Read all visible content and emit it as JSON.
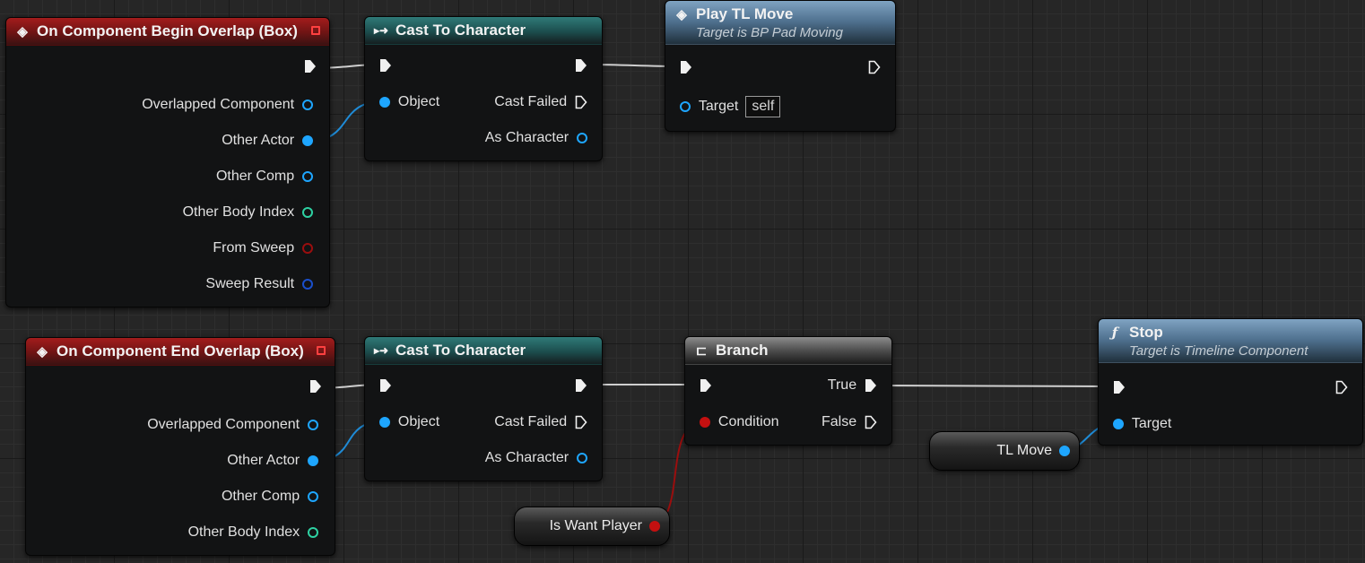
{
  "nodes": {
    "begin_overlap": {
      "title": "On Component Begin Overlap (Box)",
      "pins": [
        "Overlapped Component",
        "Other Actor",
        "Other Comp",
        "Other Body Index",
        "From Sweep",
        "Sweep Result"
      ]
    },
    "cast_top": {
      "title": "Cast To Character",
      "object": "Object",
      "cast_failed": "Cast Failed",
      "as_character": "As Character"
    },
    "play_tl": {
      "title": "Play TL Move",
      "subtitle": "Target is BP Pad Moving",
      "target": "Target",
      "target_value": "self"
    },
    "end_overlap": {
      "title": "On Component End Overlap (Box)",
      "pins": [
        "Overlapped Component",
        "Other Actor",
        "Other Comp",
        "Other Body Index"
      ]
    },
    "cast_bottom": {
      "title": "Cast To Character",
      "object": "Object",
      "cast_failed": "Cast Failed",
      "as_character": "As Character"
    },
    "branch": {
      "title": "Branch",
      "true_label": "True",
      "false_label": "False",
      "condition": "Condition"
    },
    "stop": {
      "title": "Stop",
      "subtitle": "Target is Timeline Component",
      "target": "Target"
    },
    "tl_move_var": {
      "label": "TL Move"
    },
    "is_want_player_var": {
      "label": "Is Want Player"
    }
  },
  "icons": {
    "event": "event-diamond-icon",
    "cast": "cast-arrow-icon",
    "branch": "branch-icon",
    "function": "function-f-icon"
  },
  "colors": {
    "event_header": "#a31c1c",
    "cast_header": "#2f7a78",
    "function_header": "#7fa3c2",
    "object_pin": "#1ea6ff",
    "int_pin": "#2ed1a2",
    "bool_pin": "#c41010"
  }
}
